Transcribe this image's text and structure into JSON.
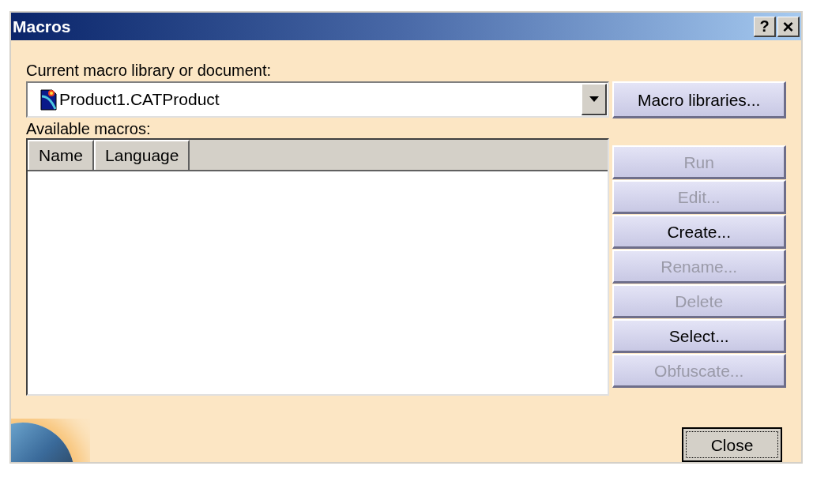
{
  "window": {
    "title": "Macros",
    "help_button": "?",
    "close_button": "×"
  },
  "library_label": "Current macro library or document:",
  "library_select": {
    "value": "Product1.CATProduct"
  },
  "macro_libraries_button": "Macro libraries...",
  "macros_label": "Available macros:",
  "table": {
    "columns": [
      "Name",
      "Language"
    ]
  },
  "buttons": [
    {
      "label": "Run",
      "disabled": true
    },
    {
      "label": "Edit...",
      "disabled": true
    },
    {
      "label": "Create...",
      "disabled": false
    },
    {
      "label": "Rename...",
      "disabled": true
    },
    {
      "label": "Delete",
      "disabled": true
    },
    {
      "label": "Select...",
      "disabled": false
    },
    {
      "label": "Obfuscate...",
      "disabled": true
    }
  ],
  "close_dialog_button": "Close"
}
